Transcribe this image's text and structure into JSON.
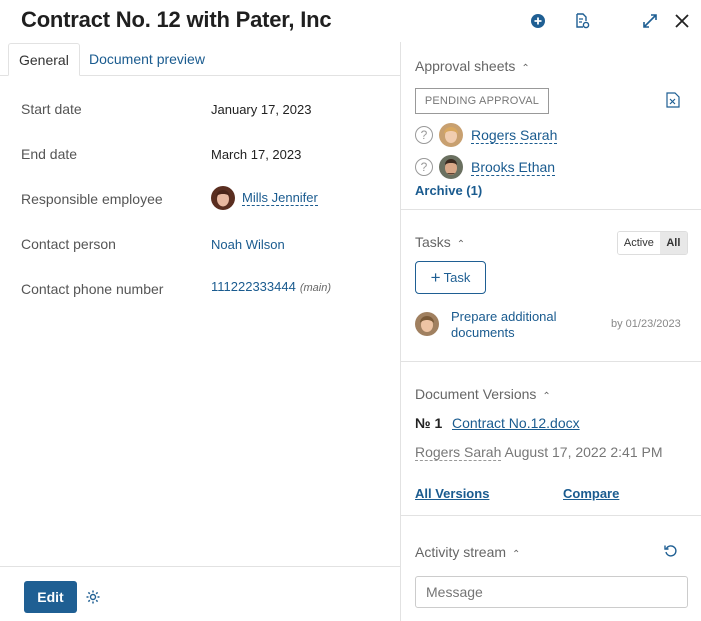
{
  "header": {
    "title": "Contract No. 12 with Pater, Inc"
  },
  "tabs": [
    {
      "label": "General"
    },
    {
      "label": "Document preview"
    }
  ],
  "fields": {
    "start_date": {
      "label": "Start date",
      "value": "January 17, 2023"
    },
    "end_date": {
      "label": "End date",
      "value": "March 17, 2023"
    },
    "responsible": {
      "label": "Responsible employee",
      "value": "Mills Jennifer"
    },
    "contact_person": {
      "label": "Contact person",
      "value": "Noah Wilson"
    },
    "contact_phone": {
      "label": "Contact phone number",
      "value": "111222333444",
      "note": "(main)"
    }
  },
  "footer": {
    "edit_label": "Edit"
  },
  "approval": {
    "title": "Approval sheets",
    "status": "PENDING APPROVAL",
    "approvers": [
      {
        "name": "Rogers Sarah"
      },
      {
        "name": "Brooks Ethan"
      }
    ],
    "archive": "Archive (1)"
  },
  "tasks": {
    "title": "Tasks",
    "toggle": {
      "active": "Active",
      "all": "All"
    },
    "add_label": "Task",
    "item": {
      "line1": "Prepare additional",
      "line2": "documents",
      "due": "by 01/23/2023"
    }
  },
  "versions": {
    "title": "Document Versions",
    "number": "№ 1",
    "file": "Contract No.12.docx",
    "author": "Rogers Sarah",
    "date": "August 17, 2022 2:41 PM",
    "all_versions": "All Versions",
    "compare": "Compare"
  },
  "activity": {
    "title": "Activity stream",
    "placeholder": "Message"
  },
  "colors": {
    "accent": "#1f5f93",
    "link": "#1a5b8f"
  }
}
